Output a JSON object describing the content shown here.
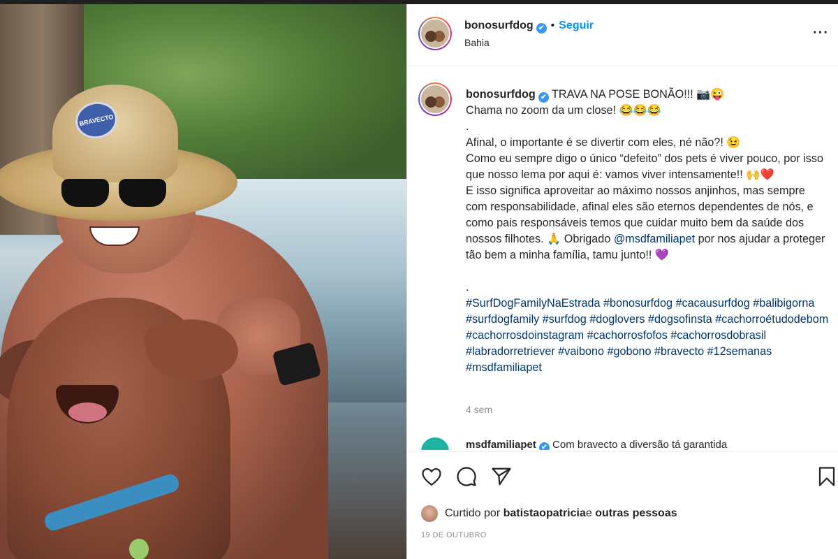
{
  "post": {
    "username": "bonosurfdog",
    "verified_mark": "✔",
    "separator": "•",
    "follow_label": "Seguir",
    "location": "Bahia",
    "more_label": "···",
    "hat_badge": "BRAVECTO"
  },
  "caption": {
    "username": "bonosurfdog",
    "lines": [
      " TRAVA NA POSE BONÃO!!! 📷😜",
      "Chama no zoom da um close! 😂😂😂",
      ".",
      "Afinal, o importante é se divertir com eles, né não?! 😉",
      "Como eu sempre digo o único “defeito” dos pets é viver pouco, por isso que nosso lema por aqui é: vamos viver intensamente!! 🙌❤️",
      "E isso significa aproveitar ao máximo nossos anjinhos, mas sempre com responsabilidade, afinal eles são eternos dependentes de nós, e como pais responsáveis temos que cuidar muito bem da saúde dos nossos filhotes. 🙏 Obrigado "
    ],
    "mention": "@msdfamiliapet",
    "after_mention": " por nos ajudar a proteger tão bem a minha família, tamu junto!! 💜",
    "spacer": ".",
    "hashtags": "#SurfDogFamilyNaEstrada #bonosurfdog #cacausurfdog #balibigorna #surfdogfamily #surfdog #doglovers #dogsofinsta #cachorroétudodebom #cachorrosdoinstagram #cachorrosfofos #cachorrosdobrasil #labradorretriever #vaibono #gobono #bravecto #12semanas #msdfamiliapet",
    "time_ago": "4 sem"
  },
  "comment2": {
    "username": "msdfamiliapet",
    "text": " Com bravecto a diversão tá garantida"
  },
  "actions": {
    "liked_by_prefix": "Curtido por ",
    "liked_by_user": "batistaopatricia",
    "liked_by_conj": " e ",
    "liked_by_others": "outras pessoas",
    "date": "19 DE OUTUBRO"
  },
  "icons": [
    "heart-icon",
    "comment-icon",
    "share-icon",
    "bookmark-icon",
    "more-options-icon",
    "verified-badge-icon"
  ],
  "colors": {
    "link": "#00376b",
    "follow": "#0095f6",
    "verified": "#3897f0",
    "muted": "#8e8e8e"
  }
}
